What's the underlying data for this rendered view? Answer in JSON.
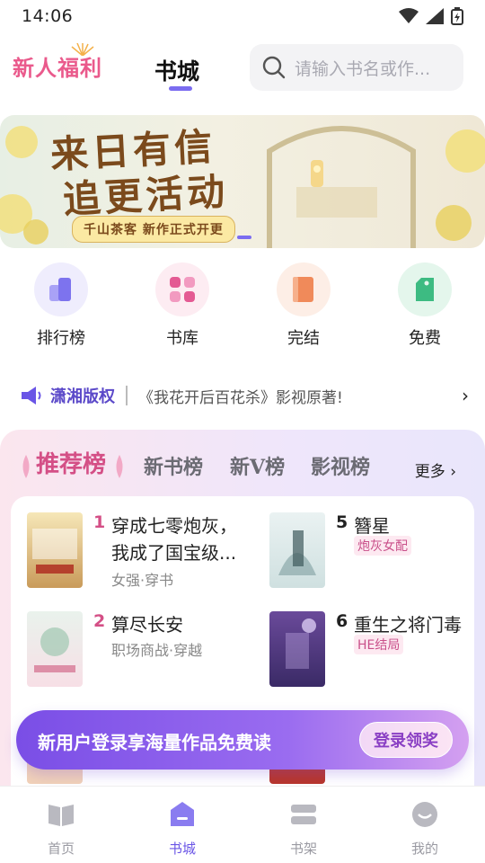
{
  "status_bar": {
    "time": "14:06"
  },
  "top_nav": {
    "welfare_label": "新人福利",
    "active_tab": "书城",
    "search_placeholder": "请输入书名或作..."
  },
  "banner": {
    "title_line1": "来日有信",
    "title_line2": "追更活动",
    "subtitle": "千山茶客  新作正式开更"
  },
  "quick_entries": [
    {
      "label": "排行榜",
      "icon": "leaderboard-icon",
      "color": "#8d86f2"
    },
    {
      "label": "书库",
      "icon": "library-icon",
      "color": "#e45a93"
    },
    {
      "label": "完结",
      "icon": "finished-book-icon",
      "color": "#f08a5a"
    },
    {
      "label": "免费",
      "icon": "free-tag-icon",
      "color": "#3dbb82"
    }
  ],
  "notice": {
    "brand": "潇湘版权",
    "message": "《我花开后百花杀》影视原著!",
    "arrow": "›"
  },
  "ranking": {
    "tabs": [
      "推荐榜",
      "新书榜",
      "新V榜",
      "影视榜"
    ],
    "active_tab": "推荐榜",
    "more_label": "更多 ›",
    "books": [
      {
        "rank": "1",
        "title": "穿成七零炮灰，我成了国宝级...",
        "meta": "女强·穿书",
        "tag": "",
        "rank_color": "#d44f86"
      },
      {
        "rank": "2",
        "title": "算尽长安",
        "meta": "职场商战·穿越",
        "tag": "",
        "rank_color": "#d44f86"
      },
      {
        "rank": "5",
        "title": "簪星",
        "meta": "",
        "tag": "炮灰女配",
        "rank_color": "#222222"
      },
      {
        "rank": "6",
        "title": "重生之将门毒",
        "meta": "",
        "tag": "HE结局",
        "rank_color": "#222222"
      }
    ]
  },
  "login_banner": {
    "text": "新用户登录享海量作品免费读",
    "button": "登录领奖"
  },
  "bottom_nav": [
    {
      "label": "首页",
      "icon": "home-book-icon"
    },
    {
      "label": "书城",
      "icon": "bookstore-icon"
    },
    {
      "label": "书架",
      "icon": "bookshelf-icon"
    },
    {
      "label": "我的",
      "icon": "profile-icon"
    }
  ],
  "colors": {
    "accent": "#6a55e6",
    "pink": "#d44f86"
  }
}
